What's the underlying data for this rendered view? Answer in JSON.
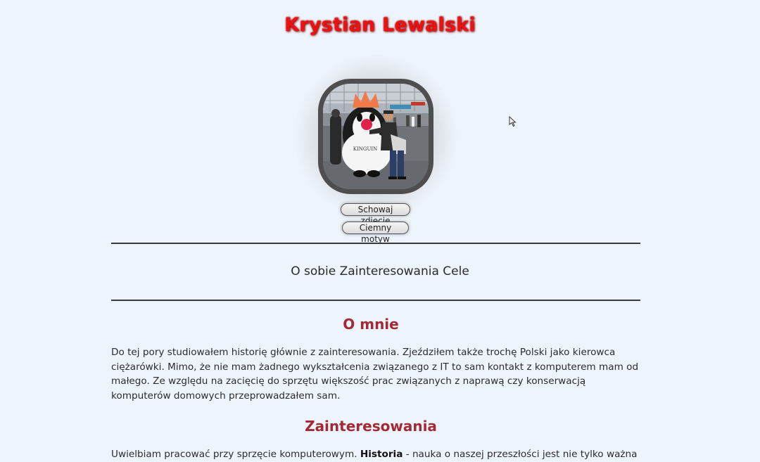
{
  "header": {
    "title": "Krystian Lewalski"
  },
  "photo": {
    "caption_text": "KINGUIN"
  },
  "buttons": {
    "hide_photo": "Schowaj zdjęcie",
    "dark_theme": "Ciemny motyw"
  },
  "nav": {
    "items": [
      "O sobie",
      "Zainteresowania",
      "Cele"
    ]
  },
  "about": {
    "heading": "O mnie",
    "text": "Do tej pory studiowałem historię głównie z zainteresowania. Zjeździłem także trochę Polski jako kierowca ciężarówki. Mimo, że nie mam żadnego wykształcenia związanego z IT to sam kontakt z komputerem mam od małego. Ze względu na zacięcię do sprzętu większość prac związanych z naprawą czy konserwacją komputerów domowych przeprowadzałem sam."
  },
  "interests": {
    "heading": "Zainteresowania",
    "text_start": "Uwielbiam pracować przy sprzęcie komputerowym.",
    "bold_word": "Historia",
    "text_rest": "- nauka o naszej przeszłości jest nie tylko ważna ale i może"
  },
  "colors": {
    "background": "#eef4fb",
    "title": "#ee1111",
    "section_heading": "#a22a35",
    "text": "#2b2b2b"
  }
}
